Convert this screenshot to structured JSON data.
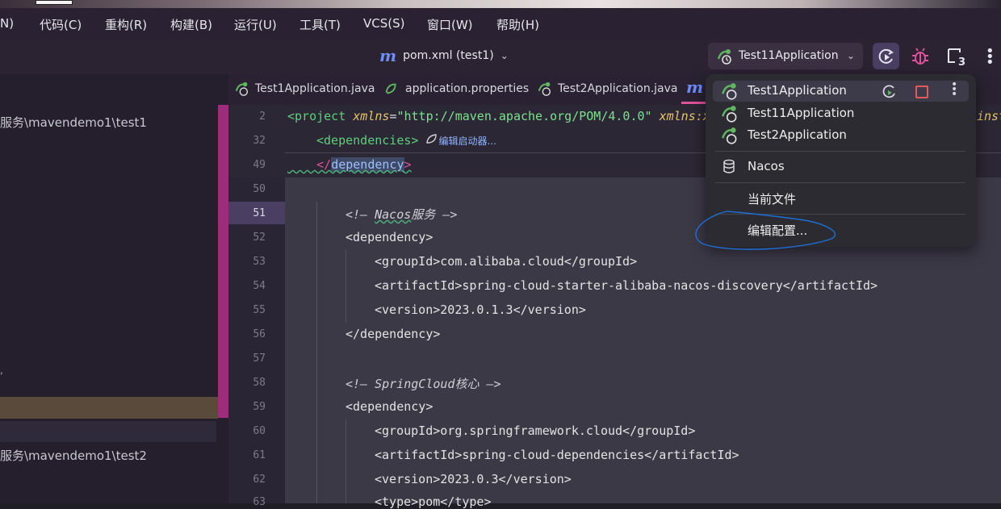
{
  "menu": [
    "N)",
    "代码(C)",
    "重构(R)",
    "构建(B)",
    "运行(U)",
    "工具(T)",
    "VCS(S)",
    "窗口(W)",
    "帮助(H)"
  ],
  "toolbar": {
    "project_file": "pom.xml (test1)",
    "run_config": "Test11Application"
  },
  "sidebar": {
    "path1": "服务\\mavendemo1\\test1",
    "path2": "服务\\mavendemo1\\test2"
  },
  "tabs": [
    "Test1Application.java",
    "application.properties",
    "Test2Application.java"
  ],
  "editor": {
    "line_numbers": [
      "2",
      "32",
      "49",
      "50",
      "51",
      "52",
      "53",
      "54",
      "55",
      "56",
      "57",
      "58",
      "59",
      "60",
      "61",
      "62",
      "63"
    ],
    "sticky": {
      "project_open": "<project",
      "xmlns_attr": "xmlns",
      "xmlns_val": "\"http://maven.apache.org/POM/4.0.0\"",
      "xmlns2_attr": "xmlns:x",
      "trailing": "inst",
      "dependencies_tag": "<dependencies>",
      "hint": "编辑启动器..."
    },
    "lines": {
      "l49_open": "</",
      "l49_tag": "dependency",
      "l49_close": ">",
      "l51_comment_open": "<!—",
      "l51_comment_text": "Nacos",
      "l51_comment_cn": "服务",
      "l51_comment_close": "—>",
      "l52": "<dependency>",
      "l53": "<groupId>com.alibaba.cloud</groupId>",
      "l54": "<artifactId>spring-cloud-starter-alibaba-nacos-discovery</artifactId>",
      "l55": "<version>2023.0.1.3</version>",
      "l56": "</dependency>",
      "l58_comment_open": "<!—",
      "l58_comment_text": "SpringCloud",
      "l58_comment_cn": "核心",
      "l58_comment_close": "—>",
      "l59": "<dependency>",
      "l60": "<groupId>org.springframework.cloud</groupId>",
      "l61": "<artifactId>spring-cloud-dependencies</artifactId>",
      "l62": "<version>2023.0.3</version>",
      "l63": "<type>pom</type>"
    }
  },
  "popup": {
    "items": [
      "Test1Application",
      "Test11Application",
      "Test2Application"
    ],
    "nacos": "Nacos",
    "current_file": "当前文件",
    "edit_config": "编辑配置..."
  },
  "colors": {
    "accent_pink": "#e0529c",
    "run_green": "#5fb85f",
    "debug_pink": "#e0529c",
    "annotation_blue": "#1e6fd6"
  }
}
